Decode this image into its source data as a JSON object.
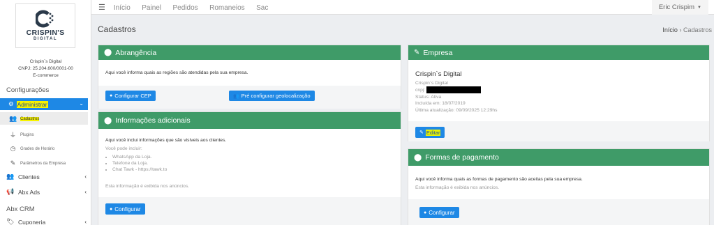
{
  "brand": {
    "name": "CRISPIN'S",
    "sub": "DIGITAL"
  },
  "company": {
    "name": "Crispin`s Digital",
    "cnpj": "CNPJ: 25.204.600/0001-00",
    "segment": "E-commerce"
  },
  "sidebar": {
    "section_config": "Configurações",
    "admin_label": "Administrar",
    "sub_items": [
      {
        "label": "Cadastros"
      },
      {
        "label": "Plugins"
      },
      {
        "label": "Grades de Horário"
      },
      {
        "label": "Parâmetros da Empresa"
      }
    ],
    "nav_items": [
      {
        "label": "Clientes"
      },
      {
        "label": "Abx Ads"
      }
    ],
    "section_crm": "Abx CRM",
    "crm_items": [
      {
        "label": "Cuponeria"
      }
    ]
  },
  "topbar": {
    "nav": [
      "Início",
      "Painel",
      "Pedidos",
      "Romaneios",
      "Sac"
    ],
    "user": "Eric Crispim"
  },
  "page": {
    "title": "Cadastros",
    "breadcrumb_home": "Início",
    "breadcrumb_sep": "›",
    "breadcrumb_current": "Cadastros"
  },
  "abrangencia": {
    "title": "Abrangência",
    "text": "Aqui você informa quais as regiões são atendidas pela sua empresa.",
    "btn_cep": "Configurar CEP",
    "btn_geo": "Pré configurar geolocalização"
  },
  "info_adicionais": {
    "title": "Informações adicionais",
    "text": "Aqui você inclui informações que são visíveis aos clientes.",
    "can_include": "Você pode incluir:",
    "bullets": [
      "WhatsApp da Loja.",
      "Telefone da Loja.",
      "Chat Tawk - https://tawk.to"
    ],
    "note": "Esta informação é exibida nos anúncios.",
    "btn": "Configurar"
  },
  "empresa": {
    "title": "Empresa",
    "name": "Crispin`s Digital",
    "line1": "Crispin`s Digital",
    "cnpj_label": "cnpj:",
    "status": "Status: Ativa",
    "included": "Incluída em: 18/07/2019",
    "updated": "Última atualização: 09/09/2025 12:29hs",
    "btn": "Editar"
  },
  "pagamento": {
    "title": "Formas de pagamento",
    "text": "Aqui você informa quais as formas de pagamento são aceitas pela sua empresa.",
    "note": "Esta informação é exibida nos anúncios.",
    "btn": "Configurar"
  },
  "colors": {
    "accent": "#1e88e5",
    "card_header": "#3f9b68",
    "highlight": "#f7f300"
  }
}
